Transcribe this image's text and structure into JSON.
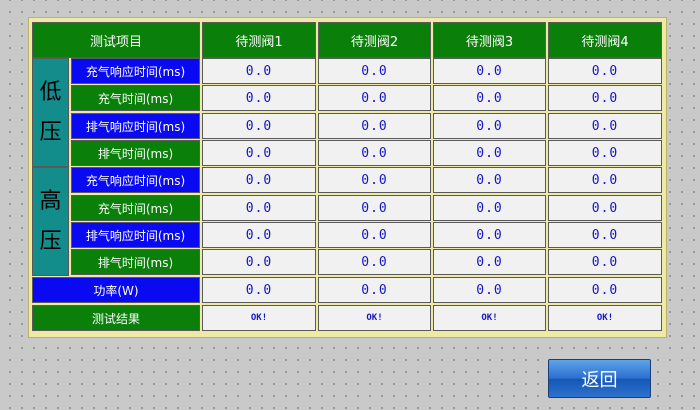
{
  "table": {
    "header": {
      "item_label": "测试项目",
      "valves": [
        "待测阀1",
        "待测阀2",
        "待测阀3",
        "待测阀4"
      ]
    },
    "groups": [
      {
        "label_chars": [
          "低",
          "压"
        ],
        "rows": [
          {
            "label": "充气响应时间(ms)",
            "color": "blue",
            "values": [
              "0.0",
              "0.0",
              "0.0",
              "0.0"
            ]
          },
          {
            "label": "充气时间(ms)",
            "color": "green",
            "values": [
              "0.0",
              "0.0",
              "0.0",
              "0.0"
            ]
          },
          {
            "label": "排气响应时间(ms)",
            "color": "blue",
            "values": [
              "0.0",
              "0.0",
              "0.0",
              "0.0"
            ]
          },
          {
            "label": "排气时间(ms)",
            "color": "green",
            "values": [
              "0.0",
              "0.0",
              "0.0",
              "0.0"
            ]
          }
        ]
      },
      {
        "label_chars": [
          "高",
          "压"
        ],
        "rows": [
          {
            "label": "充气响应时间(ms)",
            "color": "blue",
            "values": [
              "0.0",
              "0.0",
              "0.0",
              "0.0"
            ]
          },
          {
            "label": "充气时间(ms)",
            "color": "green",
            "values": [
              "0.0",
              "0.0",
              "0.0",
              "0.0"
            ]
          },
          {
            "label": "排气响应时间(ms)",
            "color": "blue",
            "values": [
              "0.0",
              "0.0",
              "0.0",
              "0.0"
            ]
          },
          {
            "label": "排气时间(ms)",
            "color": "green",
            "values": [
              "0.0",
              "0.0",
              "0.0",
              "0.0"
            ]
          }
        ]
      }
    ],
    "power_row": {
      "label": "功率(W)",
      "color": "blue",
      "values": [
        "0.0",
        "0.0",
        "0.0",
        "0.0"
      ]
    },
    "result_row": {
      "label": "测试结果",
      "color": "green",
      "values": [
        "OK!",
        "OK!",
        "OK!",
        "OK!"
      ]
    }
  },
  "back_button": {
    "label": "返回"
  },
  "colors": {
    "header_green": "#0a7f0a",
    "label_blue": "#0a0af2",
    "group_teal": "#138c8c",
    "value_text": "#1414c8",
    "panel_yellow": "#efe9a6"
  }
}
